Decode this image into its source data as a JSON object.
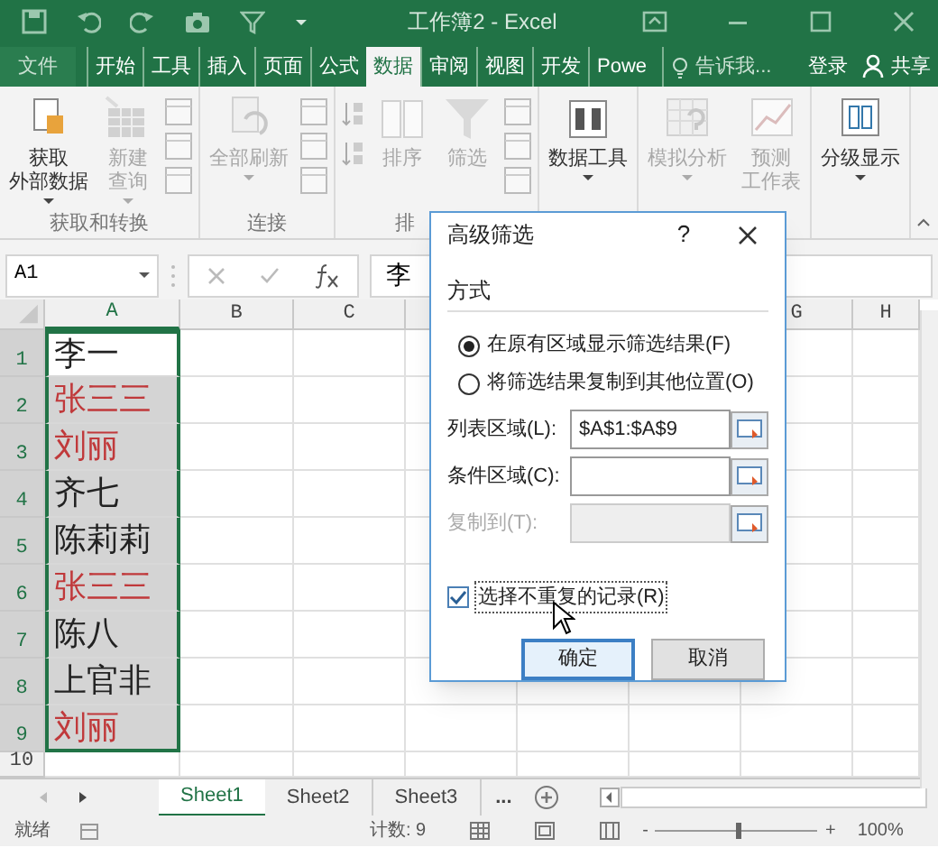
{
  "window": {
    "title": "工作簿2 - Excel"
  },
  "tabs": [
    {
      "label": "文件",
      "kind": "file",
      "selected": false
    },
    {
      "label": "开始",
      "kind": "tab",
      "selected": false
    },
    {
      "label": "工具",
      "kind": "tab",
      "selected": false
    },
    {
      "label": "插入",
      "kind": "tab",
      "selected": false
    },
    {
      "label": "页面",
      "kind": "tab",
      "selected": false
    },
    {
      "label": "公式",
      "kind": "tab",
      "selected": false
    },
    {
      "label": "数据",
      "kind": "tab",
      "selected": true
    },
    {
      "label": "审阅",
      "kind": "tab",
      "selected": false
    },
    {
      "label": "视图",
      "kind": "tab",
      "selected": false
    },
    {
      "label": "开发",
      "kind": "tab",
      "selected": false
    },
    {
      "label": "Powe",
      "kind": "tab",
      "selected": false
    }
  ],
  "tell_me": "告诉我...",
  "sign_in": "登录",
  "share": "共享",
  "ribbon": {
    "groups": [
      {
        "label": "获取和转换",
        "items": [
          {
            "kind": "large",
            "lines": [
              "获取",
              "外部数据"
            ],
            "disabled": false,
            "dropdown": true
          },
          {
            "kind": "large",
            "lines": [
              "新建",
              "查询"
            ],
            "disabled": true,
            "dropdown": true
          },
          {
            "kind": "icons"
          }
        ]
      },
      {
        "label": "连接",
        "items": [
          {
            "kind": "large",
            "lines": [
              "全部刷新"
            ],
            "disabled": true,
            "dropdown": true
          },
          {
            "kind": "icons"
          }
        ]
      },
      {
        "label": "排",
        "items": [
          {
            "kind": "sort"
          },
          {
            "kind": "large",
            "lines": [
              "排序"
            ],
            "disabled": true,
            "dropdown": false
          },
          {
            "kind": "large",
            "lines": [
              "筛选"
            ],
            "disabled": true,
            "dropdown": false
          },
          {
            "kind": "icons"
          }
        ]
      },
      {
        "items": [
          {
            "kind": "large",
            "lines": [
              "数据工具"
            ],
            "disabled": false,
            "dropdown": true
          }
        ]
      },
      {
        "items": [
          {
            "kind": "large",
            "lines": [
              "模拟分析"
            ],
            "disabled": true,
            "dropdown": true
          },
          {
            "kind": "large",
            "lines": [
              "预测",
              "工作表"
            ],
            "disabled": true,
            "dropdown": false
          }
        ]
      },
      {
        "items": [
          {
            "kind": "large",
            "lines": [
              "分级显示"
            ],
            "disabled": false,
            "dropdown": true
          }
        ]
      }
    ]
  },
  "formula_bar": {
    "name_box": "A1",
    "formula": "李"
  },
  "columns": [
    {
      "label": "A",
      "selected": true
    },
    {
      "label": "B",
      "selected": false
    },
    {
      "label": "C",
      "selected": false
    },
    {
      "label": "G",
      "selected": false
    },
    {
      "label": "H",
      "selected": false
    }
  ],
  "rows": [
    {
      "number": "1",
      "selected": true,
      "cell": {
        "text": "李一",
        "color": "#222222",
        "active": true
      }
    },
    {
      "number": "2",
      "selected": true,
      "cell": {
        "text": "张三三",
        "color": "#c0393b",
        "active": false
      }
    },
    {
      "number": "3",
      "selected": true,
      "cell": {
        "text": "刘丽",
        "color": "#c0393b",
        "active": false
      }
    },
    {
      "number": "4",
      "selected": true,
      "cell": {
        "text": "齐七",
        "color": "#222222",
        "active": false
      }
    },
    {
      "number": "5",
      "selected": true,
      "cell": {
        "text": "陈莉莉",
        "color": "#222222",
        "active": false
      }
    },
    {
      "number": "6",
      "selected": true,
      "cell": {
        "text": "张三三",
        "color": "#c0393b",
        "active": false
      }
    },
    {
      "number": "7",
      "selected": true,
      "cell": {
        "text": "陈八",
        "color": "#222222",
        "active": false
      }
    },
    {
      "number": "8",
      "selected": true,
      "cell": {
        "text": "上官非",
        "color": "#222222",
        "active": false
      }
    },
    {
      "number": "9",
      "selected": true,
      "cell": {
        "text": "刘丽",
        "color": "#c0393b",
        "active": false
      }
    },
    {
      "number": "10",
      "selected": false
    }
  ],
  "dialog": {
    "title": "高级筛选",
    "help": "?",
    "section": "方式",
    "options": [
      {
        "label": "在原有区域显示筛选结果(F)",
        "selected": true
      },
      {
        "label": "将筛选结果复制到其他位置(O)",
        "selected": false
      }
    ],
    "fields": [
      {
        "label": "列表区域(L):",
        "value": "$A$1:$A$9",
        "disabled": false
      },
      {
        "label": "条件区域(C):",
        "disabled": false
      },
      {
        "label": "复制到(T):",
        "disabled": true
      }
    ],
    "checkbox": {
      "label": "选择不重复的记录(R)",
      "checked": true
    },
    "buttons": [
      {
        "label": "确定",
        "default": true
      },
      {
        "label": "取消",
        "default": false
      }
    ]
  },
  "sheets": [
    {
      "label": "Sheet1",
      "selected": true
    },
    {
      "label": "Sheet2",
      "selected": false
    },
    {
      "label": "Sheet3",
      "selected": false
    }
  ],
  "more_sheets": "...",
  "status_bar": {
    "ready": "就绪",
    "count": "计数: 9",
    "zoom_out": "-",
    "zoom_slider": {
      "level": 0.5
    },
    "zoom_in": "+",
    "zoom": "100%"
  }
}
